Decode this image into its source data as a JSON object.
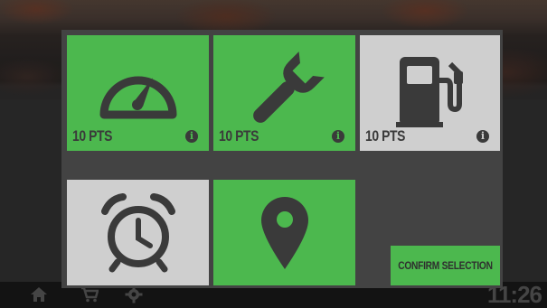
{
  "tiles": [
    {
      "id": "speed",
      "icon": "speedometer-icon",
      "points": "10 PTS",
      "state": "selected",
      "color": "#4cb84e"
    },
    {
      "id": "repair",
      "icon": "wrench-icon",
      "points": "10 PTS",
      "state": "selected",
      "color": "#4cb84e"
    },
    {
      "id": "fuel",
      "icon": "fuel-pump-icon",
      "points": "10 PTS",
      "state": "unselected",
      "color": "#cfcfcf"
    },
    {
      "id": "time",
      "icon": "alarm-clock-icon",
      "points": "",
      "state": "unselected",
      "color": "#cfcfcf"
    },
    {
      "id": "location",
      "icon": "map-pin-icon",
      "points": "",
      "state": "selected",
      "color": "#4cb84e"
    }
  ],
  "info_glyph": "i",
  "confirm_label": "CONFIRM SELECTION",
  "bottom_bar": {
    "clock": "11:26",
    "icons": [
      "home-icon",
      "cart-icon",
      "gear-icon"
    ]
  },
  "colors": {
    "accent_green": "#4cb84e",
    "tile_gray": "#cfcfcf",
    "panel_bg": "#434343",
    "icon_dark": "#3a3a3a"
  }
}
